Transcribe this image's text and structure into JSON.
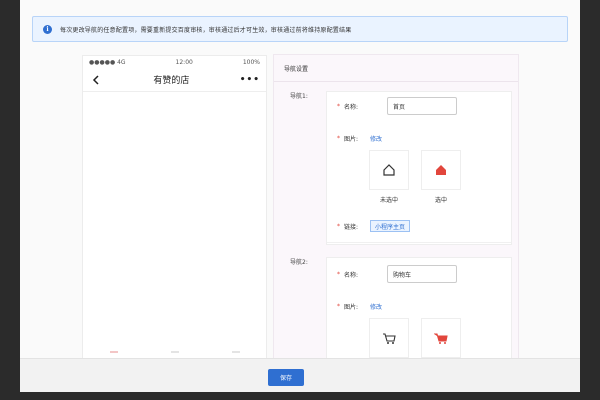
{
  "notice": {
    "icon": "info-icon",
    "icon_glyph": "i",
    "text": "每次更改导航的任意配置项，需要重新提交百度审核，审核通过后才可生效，审核通过前将维持原配置结果"
  },
  "phone": {
    "carrier": "●●●●● 4G",
    "time": "12:00",
    "battery": "100%",
    "title": "有赞的店",
    "more": "•••"
  },
  "settings": {
    "title": "导航设置",
    "nav1": {
      "label": "导航1:",
      "name_label": "名称:",
      "name_value": "首页",
      "image_label": "图片:",
      "modify_link": "修改",
      "unselected_caption": "未选中",
      "selected_caption": "选中",
      "link_label": "链接:",
      "link_value": "小程序主页"
    },
    "nav2": {
      "label": "导航2:",
      "name_label": "名称:",
      "name_value": "购物车",
      "image_label": "图片:",
      "modify_link": "修改"
    }
  },
  "footer": {
    "save_label": "保存"
  },
  "colors": {
    "accent": "#2f6fd1",
    "required": "#e2463c",
    "selected_icon": "#e2463c"
  }
}
